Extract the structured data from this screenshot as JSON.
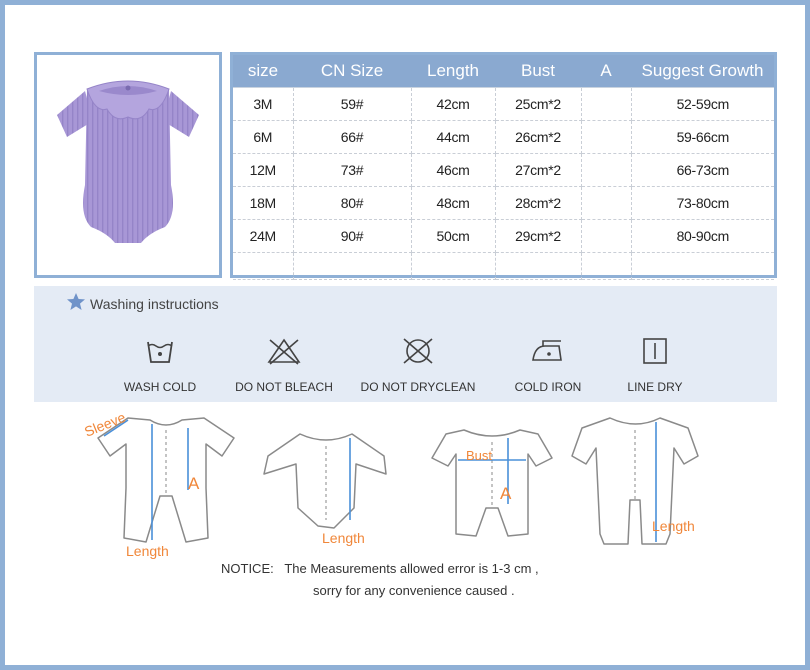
{
  "table": {
    "headers": [
      "size",
      "CN Size",
      "Length",
      "Bust",
      "A",
      "Suggest Growth"
    ],
    "rows": [
      [
        "3M",
        "59#",
        "42cm",
        "25cm*2",
        "",
        "52-59cm"
      ],
      [
        "6M",
        "66#",
        "44cm",
        "26cm*2",
        "",
        "59-66cm"
      ],
      [
        "12M",
        "73#",
        "46cm",
        "27cm*2",
        "",
        "66-73cm"
      ],
      [
        "18M",
        "80#",
        "48cm",
        "28cm*2",
        "",
        "73-80cm"
      ],
      [
        "24M",
        "90#",
        "50cm",
        "29cm*2",
        "",
        "80-90cm"
      ]
    ]
  },
  "washing": {
    "title": "Washing instructions",
    "items": [
      {
        "label": "WASH COLD",
        "icon": "wash-cold-icon"
      },
      {
        "label": "DO NOT BLEACH",
        "icon": "do-not-bleach-icon"
      },
      {
        "label": "DO NOT DRYCLEAN",
        "icon": "do-not-dryclean-icon"
      },
      {
        "label": "COLD IRON",
        "icon": "cold-iron-icon"
      },
      {
        "label": "LINE DRY",
        "icon": "line-dry-icon"
      }
    ]
  },
  "measurements": {
    "sleeve": "Sleeve",
    "a1": "A",
    "length1": "Length",
    "length2": "Length",
    "bust": "Bust",
    "a2": "A",
    "length3": "Length"
  },
  "notice": {
    "line1": "NOTICE:   The Measurements allowed error is 1-3 cm ,",
    "line2": "sorry for any convenience caused ."
  },
  "colors": {
    "frame": "#8fb0d6",
    "header": "#8aa9d0",
    "wash_bg": "#e4ebf5",
    "product": "#a897d6",
    "measure_label": "#f0873a",
    "measure_line": "#4a90d9"
  }
}
